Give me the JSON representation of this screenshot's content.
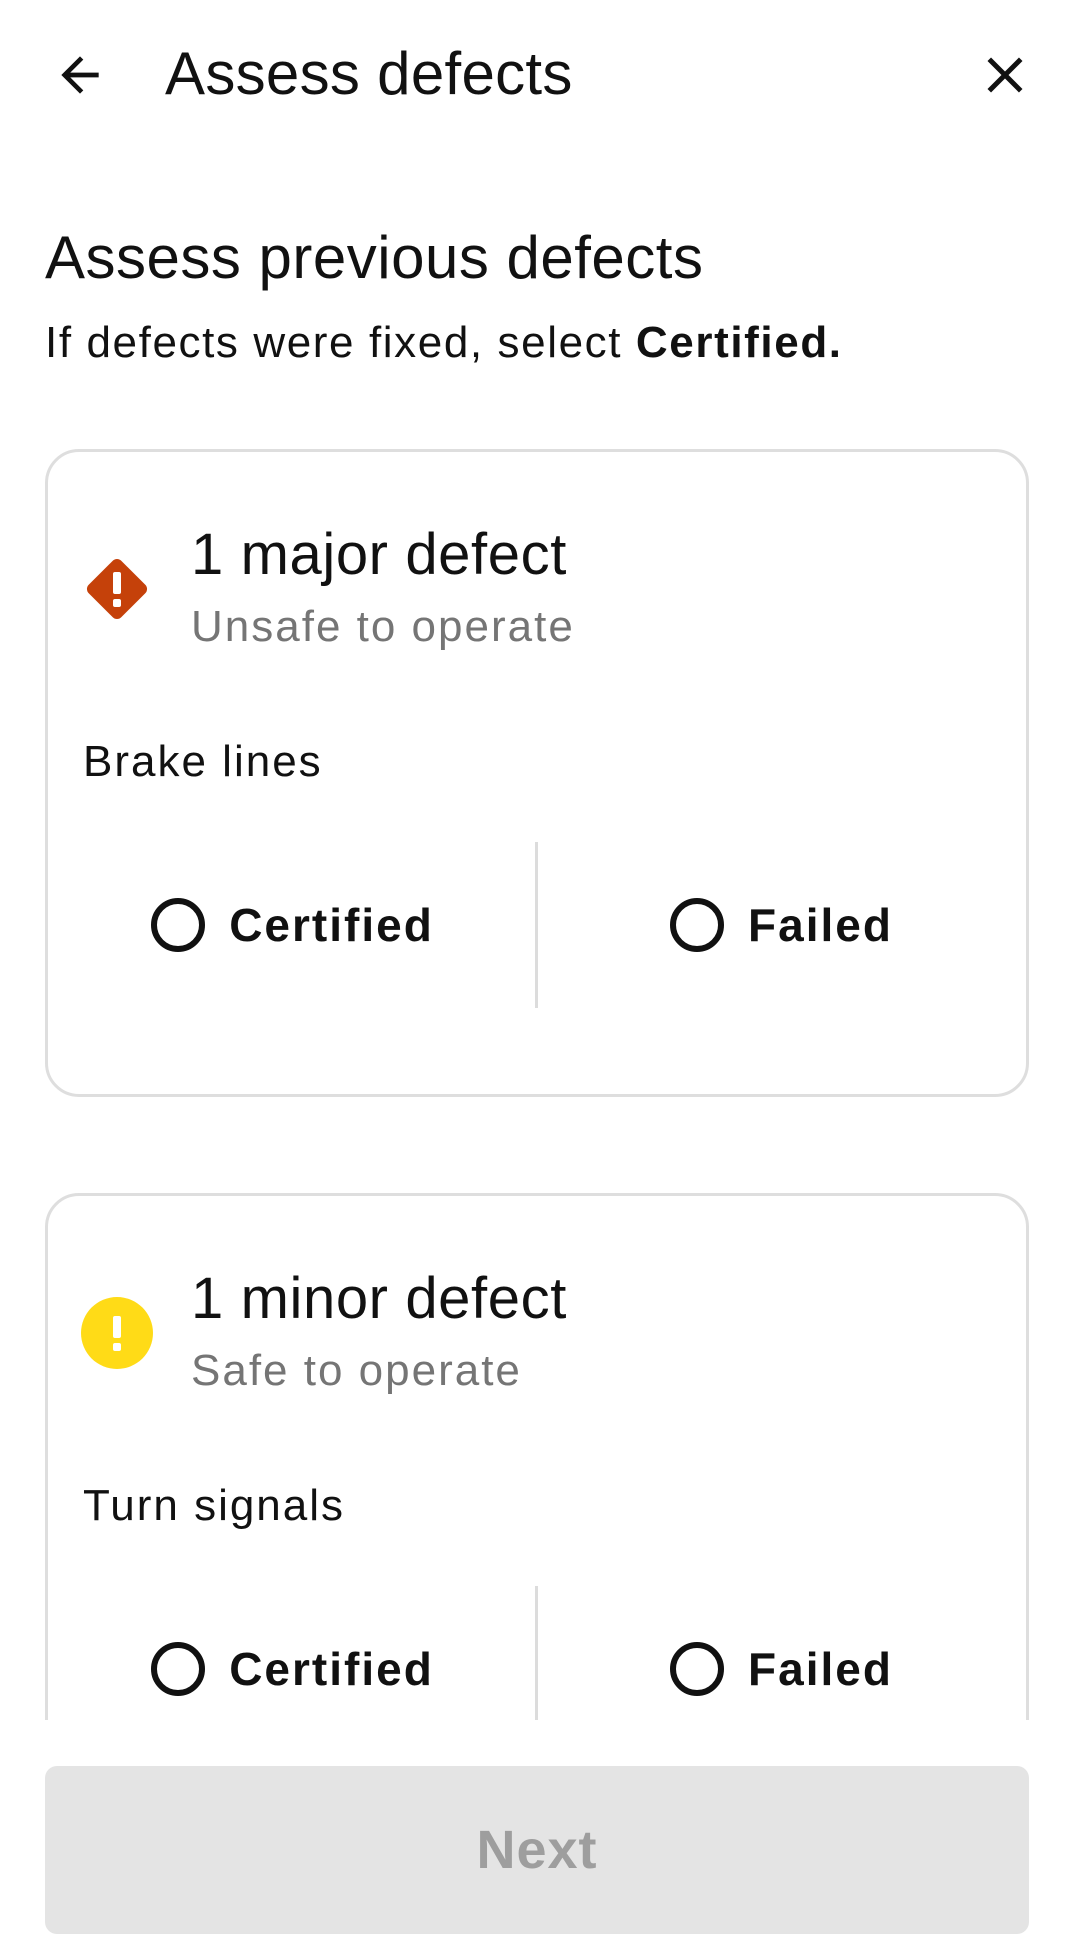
{
  "app_bar": {
    "title": "Assess defects",
    "back_icon": "arrow-back-icon",
    "close_icon": "close-icon"
  },
  "intro": {
    "title": "Assess previous defects",
    "subtitle_prefix": "If defects were fixed, select ",
    "subtitle_emphasis": "Certified."
  },
  "cards": [
    {
      "severity_icon": "warning-diamond-icon",
      "severity_color": "#C5410A",
      "title": "1 major defect",
      "subtitle": "Unsafe to operate",
      "item": "Brake lines",
      "options": [
        "Certified",
        "Failed"
      ]
    },
    {
      "severity_icon": "warning-circle-icon",
      "severity_color": "#FFDB17",
      "title": "1 minor defect",
      "subtitle": "Safe to operate",
      "item": "Turn signals",
      "options": [
        "Certified",
        "Failed"
      ]
    }
  ],
  "footer": {
    "next_label": "Next"
  }
}
